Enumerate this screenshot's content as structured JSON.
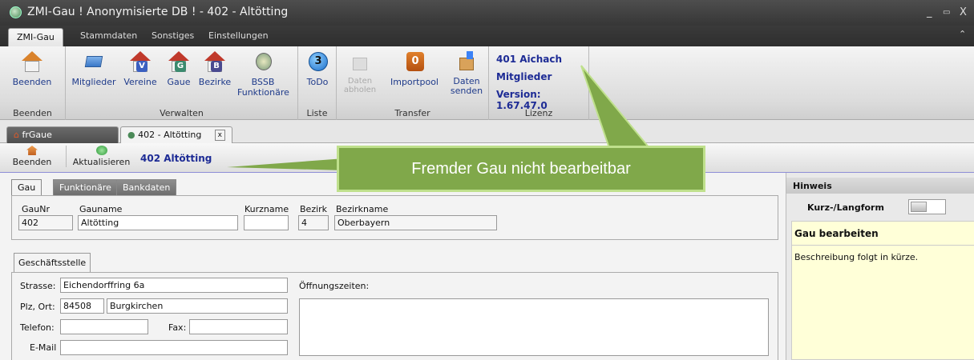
{
  "window": {
    "title": "ZMI-Gau ! Anonymisierte DB !  - 402 - Altötting",
    "min": "_",
    "max": "▭",
    "close": "X"
  },
  "ribbon_tabs": [
    "ZMI-Gau",
    "Stammdaten",
    "Sonstiges",
    "Einstellungen"
  ],
  "ribbon": {
    "groups": {
      "beenden": "Beenden",
      "verwalten": "Verwalten",
      "liste": "Liste",
      "transfer": "Transfer",
      "lizenz": "Lizenz"
    },
    "buttons": {
      "beenden": "Beenden",
      "mitglieder": "Mitglieder",
      "vereine": "Vereine",
      "gaue": "Gaue",
      "bezirke": "Bezirke",
      "bssb1": "BSSB",
      "bssb2": "Funktionäre",
      "todo": "ToDo",
      "todo_count": "3",
      "daten_abholen1": "Daten",
      "daten_abholen2": "abholen",
      "importpool": "Importpool",
      "importpool_count": "0",
      "daten_senden1": "Daten",
      "daten_senden2": "senden"
    },
    "license": {
      "line1": "401 Aichach",
      "line2": "Mitglieder",
      "line3": "Version: 1.67.47.0"
    }
  },
  "doc_tabs": {
    "tab1": "frGaue",
    "tab2": "402 - Altötting",
    "close": "x"
  },
  "toolbar": {
    "beenden": "Beenden",
    "aktualisieren": "Aktualisieren",
    "record": "402  Altötting"
  },
  "content_tabs": [
    "Gau",
    "Funktionäre",
    "Bankdaten"
  ],
  "gau": {
    "labels": {
      "gaunr": "GauNr",
      "gauname": "Gauname",
      "kurzname": "Kurzname",
      "bezirk": "Bezirk",
      "bezirkname": "Bezirkname"
    },
    "values": {
      "gaunr": "402",
      "gauname": "Altötting",
      "kurzname": "",
      "bezirk": "4",
      "bezirkname": "Oberbayern"
    }
  },
  "geschaeftsstelle": {
    "tab": "Geschäftsstelle",
    "labels": {
      "strasse": "Strasse:",
      "plzort": "Plz, Ort:",
      "telefon": "Telefon:",
      "fax": "Fax:",
      "email": "E-Mail",
      "oeffnung": "Öffnungszeiten:"
    },
    "values": {
      "strasse": "Eichendorffring 6a",
      "plz": "84508",
      "ort": "Burgkirchen",
      "telefon": "",
      "fax": "",
      "email": "",
      "oeffnung": ""
    }
  },
  "hinweis": {
    "header": "Hinweis",
    "toggle_label": "Kurz-/Langform",
    "title": "Gau bearbeiten",
    "text": "Beschreibung folgt in kürze."
  },
  "callout": "Fremder Gau nicht  bearbeitbar",
  "colors": {
    "accent_blue": "#1d2b95",
    "callout_green": "#80a84a",
    "hint_bg": "#ffffd8"
  }
}
